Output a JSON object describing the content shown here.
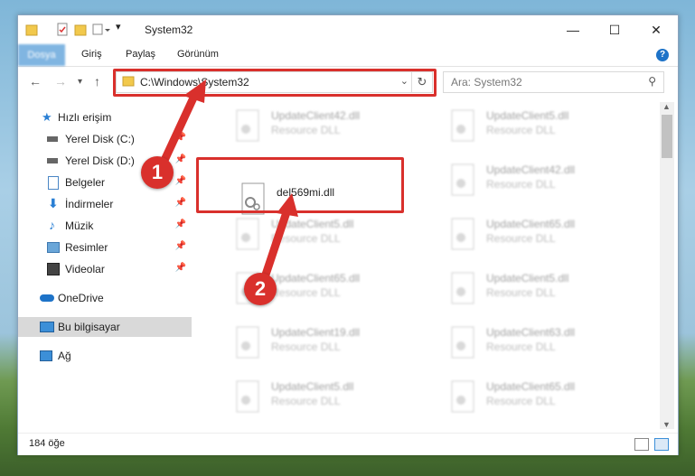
{
  "window": {
    "title": "System32",
    "controls": {
      "minimize": "—",
      "maximize": "☐",
      "close": "✕"
    }
  },
  "ribbon": {
    "tabs": [
      "Dosya",
      "Giriş",
      "Paylaş",
      "Görünüm"
    ],
    "help_icon": "?"
  },
  "address": {
    "path": "C:\\Windows\\System32",
    "search_placeholder": "Ara: System32"
  },
  "sidebar": {
    "items": [
      {
        "label": "Hızlı erişim",
        "icon": "star-icon"
      },
      {
        "label": "Yerel Disk (C:)",
        "icon": "drive-icon",
        "pinned": true
      },
      {
        "label": "Yerel Disk (D:)",
        "icon": "drive-icon",
        "pinned": true
      },
      {
        "label": "Belgeler",
        "icon": "documents-icon",
        "pinned": true
      },
      {
        "label": "İndirmeler",
        "icon": "download-icon",
        "pinned": true
      },
      {
        "label": "Müzik",
        "icon": "music-icon",
        "pinned": true
      },
      {
        "label": "Resimler",
        "icon": "pictures-icon",
        "pinned": true
      },
      {
        "label": "Videolar",
        "icon": "videos-icon",
        "pinned": true
      },
      {
        "label": "OneDrive",
        "icon": "cloud-icon"
      },
      {
        "label": "Bu bilgisayar",
        "icon": "computer-icon",
        "selected": true
      },
      {
        "label": "Ağ",
        "icon": "network-icon"
      }
    ]
  },
  "files": {
    "focused": {
      "name": "del569mi.dll"
    },
    "blurred": [
      {
        "name": "UpdateClient42.dll",
        "desc": "Resource DLL"
      },
      {
        "name": "UpdateClient5.dll",
        "desc": "Resource DLL"
      },
      {
        "name": "UpdateClient42.dll",
        "desc": "Resource DLL"
      },
      {
        "name": "UpdateClient5.dll",
        "desc": "Resource DLL"
      },
      {
        "name": "UpdateClient65.dll",
        "desc": "Resource DLL"
      },
      {
        "name": "UpdateClient65.dll",
        "desc": "Resource DLL"
      },
      {
        "name": "UpdateClient5.dll",
        "desc": "Resource DLL"
      },
      {
        "name": "UpdateClient19.dll",
        "desc": "Resource DLL"
      },
      {
        "name": "UpdateClient63.dll",
        "desc": "Resource DLL"
      },
      {
        "name": "UpdateClient5.dll",
        "desc": "Resource DLL"
      },
      {
        "name": "UpdateClient65.dll",
        "desc": "Resource DLL"
      }
    ]
  },
  "status": {
    "item_count": "184 öğe"
  },
  "annotations": {
    "step1": "1",
    "step2": "2",
    "color": "#d9302c"
  }
}
